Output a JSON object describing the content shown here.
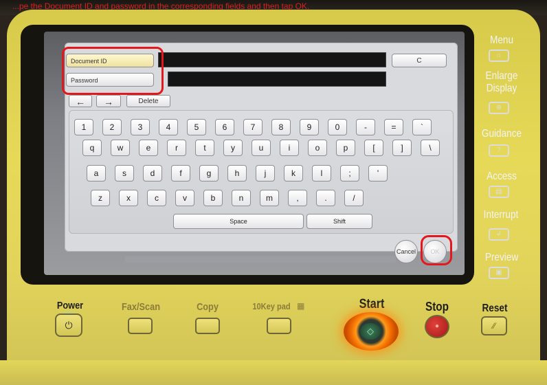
{
  "caption": "...pe the Document ID and password in the corresponding fields and then tap OK.",
  "screen": {
    "document_id_label": "Document ID",
    "password_label": "Password",
    "clear_label": "C",
    "nav_left": "←",
    "nav_right": "→",
    "delete_label": "Delete",
    "keyboard": {
      "row1": [
        "1",
        "2",
        "3",
        "4",
        "5",
        "6",
        "7",
        "8",
        "9",
        "0",
        "-",
        "=",
        "`"
      ],
      "row2": [
        "q",
        "w",
        "e",
        "r",
        "t",
        "y",
        "u",
        "i",
        "o",
        "p",
        "[",
        "]",
        "\\"
      ],
      "row3": [
        "a",
        "s",
        "d",
        "f",
        "g",
        "h",
        "j",
        "k",
        "l",
        ";",
        "'"
      ],
      "row4": [
        "z",
        "x",
        "c",
        "v",
        "b",
        "n",
        "m",
        ",",
        ".",
        "/"
      ],
      "space_label": "Space",
      "shift_label": "Shift"
    },
    "cancel_label": "Cancel",
    "ok_label": "OK"
  },
  "side_panel": {
    "menu": "Menu",
    "enlarge": "Enlarge",
    "display": "Display",
    "guidance": "Guidance",
    "guidance_icon": "?",
    "access": "Access",
    "interrupt": "Interrupt",
    "preview": "Preview"
  },
  "bottom_panel": {
    "power": "Power",
    "fax_scan": "Fax/Scan",
    "copy": "Copy",
    "tenkey": "10Key pad",
    "start": "Start",
    "stop": "Stop",
    "reset": "Reset"
  },
  "colors": {
    "highlight": "#e2181c",
    "bezel": "#e2d45a",
    "start_glow": "#ff9a1a"
  }
}
